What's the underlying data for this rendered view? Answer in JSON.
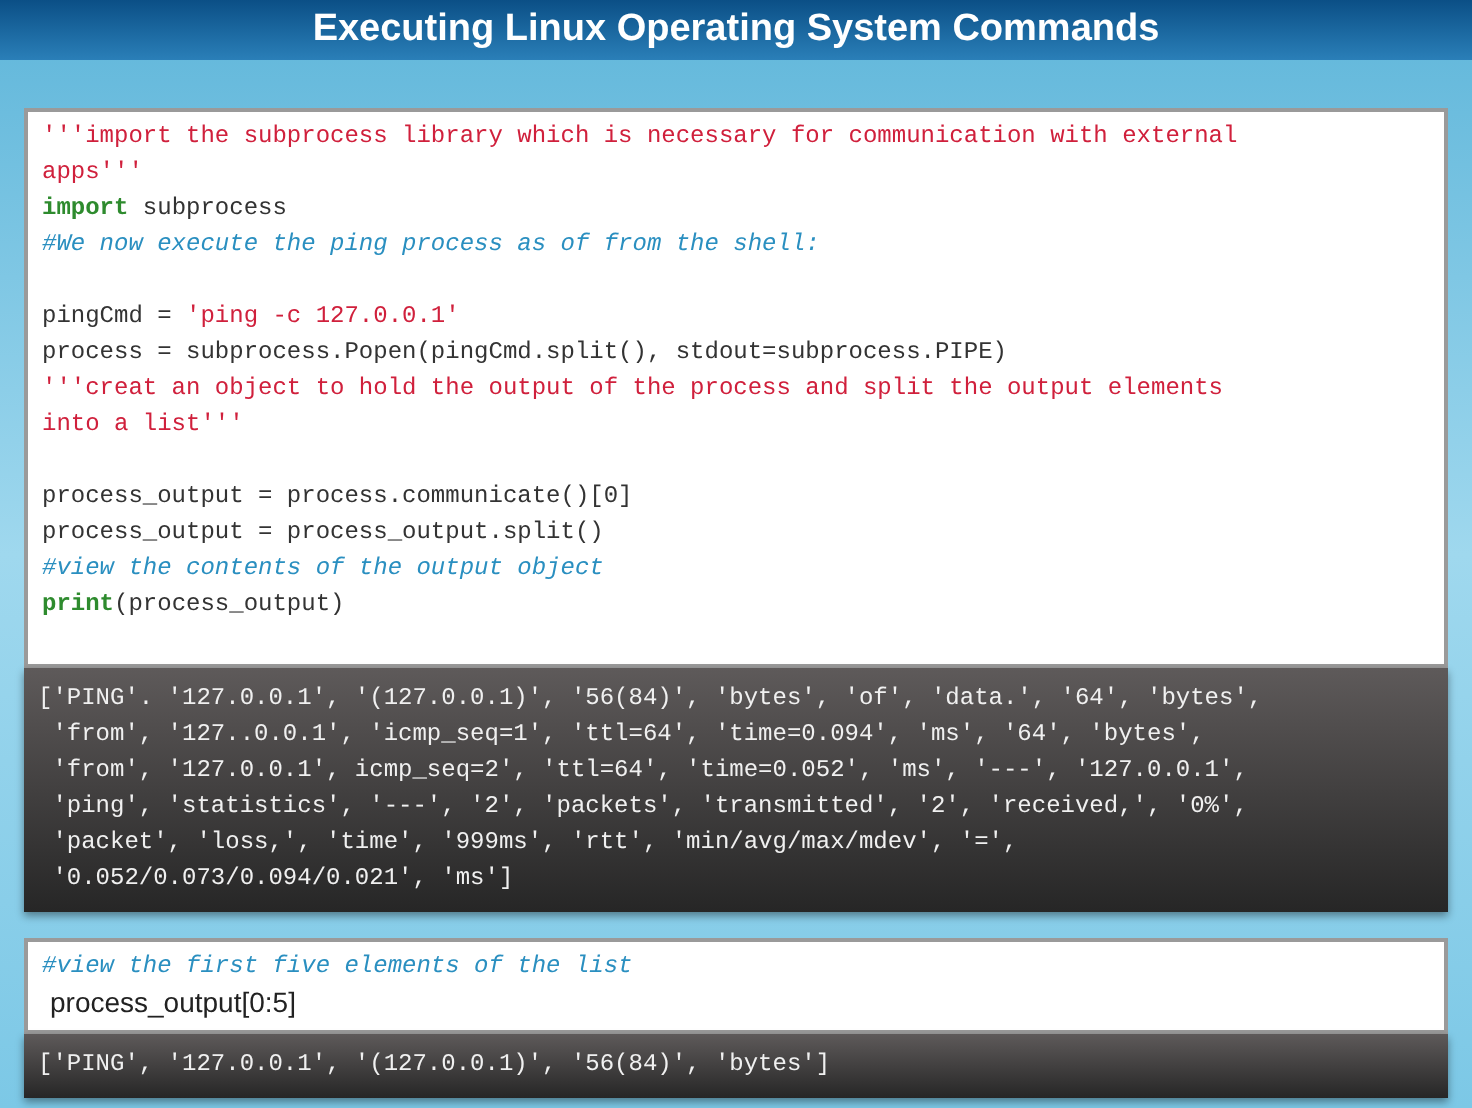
{
  "title": "Executing Linux Operating System Commands",
  "cells": [
    {
      "input": [
        {
          "kind": "code",
          "segments": [
            {
              "kind": "string",
              "text": "'''import the subprocess library which is necessary for communication with external"
            }
          ]
        },
        {
          "kind": "code",
          "segments": [
            {
              "kind": "string",
              "text": "apps'''"
            }
          ]
        },
        {
          "kind": "code",
          "segments": [
            {
              "kind": "keyword",
              "text": "import"
            },
            {
              "kind": "plain",
              "text": " subprocess"
            }
          ]
        },
        {
          "kind": "code",
          "segments": [
            {
              "kind": "comment",
              "text": "#We now execute the ping process as of from the shell:"
            }
          ]
        },
        {
          "kind": "blank"
        },
        {
          "kind": "code",
          "segments": [
            {
              "kind": "plain",
              "text": "pingCmd = "
            },
            {
              "kind": "string",
              "text": "'ping -c 127.0.0.1'"
            }
          ]
        },
        {
          "kind": "code",
          "segments": [
            {
              "kind": "plain",
              "text": "process = subprocess.Popen(pingCmd.split(), stdout=subprocess.PIPE)"
            }
          ]
        },
        {
          "kind": "code",
          "segments": [
            {
              "kind": "string",
              "text": "'''creat an object to hold the output of the process and split the output elements"
            }
          ]
        },
        {
          "kind": "code",
          "segments": [
            {
              "kind": "string",
              "text": "into a list'''"
            }
          ]
        },
        {
          "kind": "blank"
        },
        {
          "kind": "code",
          "segments": [
            {
              "kind": "plain",
              "text": "process_output = process.communicate()[0]"
            }
          ]
        },
        {
          "kind": "code",
          "segments": [
            {
              "kind": "plain",
              "text": "process_output = process_output.split()"
            }
          ]
        },
        {
          "kind": "code",
          "segments": [
            {
              "kind": "comment",
              "text": "#view the contents of the output object"
            }
          ]
        },
        {
          "kind": "code",
          "segments": [
            {
              "kind": "keyword",
              "text": "print"
            },
            {
              "kind": "plain",
              "text": "(process_output)"
            }
          ]
        },
        {
          "kind": "blank"
        }
      ],
      "output": [
        "['PING'. '127.0.0.1', '(127.0.0.1)', '56(84)', 'bytes', 'of', 'data.', '64', 'bytes',",
        " 'from', '127..0.0.1', 'icmp_seq=1', 'ttl=64', 'time=0.094', 'ms', '64', 'bytes',",
        " 'from', '127.0.0.1', icmp_seq=2', 'ttl=64', 'time=0.052', 'ms', '---', '127.0.0.1',",
        " 'ping', 'statistics', '---', '2', 'packets', 'transmitted', '2', 'received,', '0%',",
        " 'packet', 'loss,', 'time', '999ms', 'rtt', 'min/avg/max/mdev', '=',",
        " '0.052/0.073/0.094/0.021', 'ms']"
      ]
    },
    {
      "input": [
        {
          "kind": "code",
          "segments": [
            {
              "kind": "comment",
              "text": "#view the first five elements of the list"
            }
          ]
        },
        {
          "kind": "code",
          "segments": [
            {
              "kind": "sans",
              "text": "process_output[0:5]"
            }
          ]
        }
      ],
      "output": [
        "['PING', '127.0.0.1', '(127.0.0.1)', '56(84)', 'bytes']"
      ]
    }
  ]
}
